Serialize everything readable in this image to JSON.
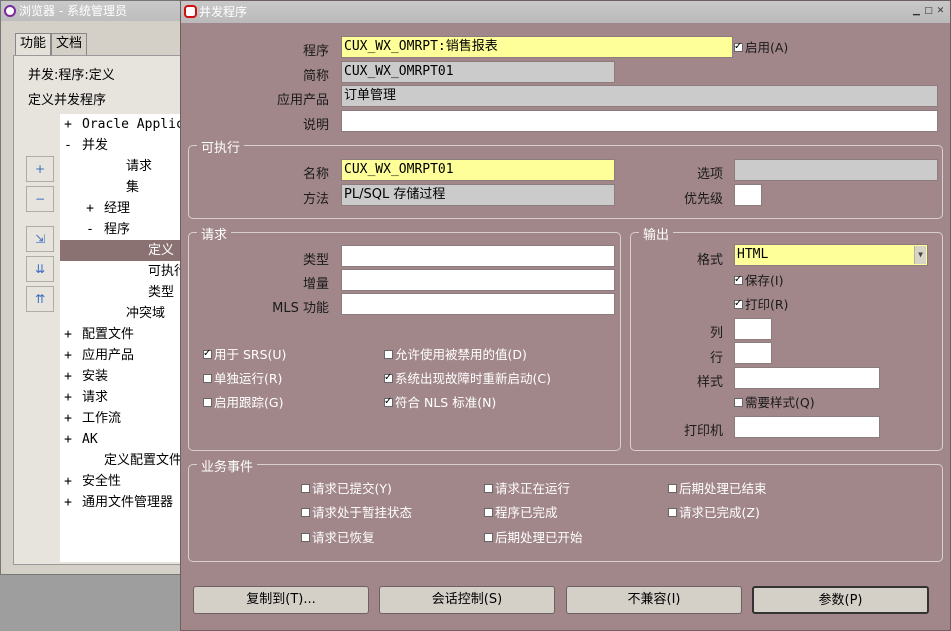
{
  "navigator": {
    "title": "浏览器 - 系统管理员",
    "tabs": [
      "功能",
      "文档"
    ],
    "function_path": "并发:程序:定义",
    "subtitle": "定义并发程序",
    "tree": [
      {
        "toggle": "+",
        "label": "Oracle Applic",
        "indent": 0
      },
      {
        "toggle": "-",
        "label": "并发",
        "indent": 0
      },
      {
        "toggle": "",
        "label": "请求",
        "indent": 2
      },
      {
        "toggle": "",
        "label": "集",
        "indent": 2
      },
      {
        "toggle": "+",
        "label": "经理",
        "indent": 1
      },
      {
        "toggle": "-",
        "label": "程序",
        "indent": 1
      },
      {
        "toggle": "",
        "label": "定义",
        "indent": 3,
        "selected": true
      },
      {
        "toggle": "",
        "label": "可执行",
        "indent": 3
      },
      {
        "toggle": "",
        "label": "类型",
        "indent": 3
      },
      {
        "toggle": "",
        "label": "冲突域",
        "indent": 2
      },
      {
        "toggle": "+",
        "label": "配置文件",
        "indent": 0
      },
      {
        "toggle": "+",
        "label": "应用产品",
        "indent": 0
      },
      {
        "toggle": "+",
        "label": "安装",
        "indent": 0
      },
      {
        "toggle": "+",
        "label": "请求",
        "indent": 0
      },
      {
        "toggle": "+",
        "label": "工作流",
        "indent": 0
      },
      {
        "toggle": "+",
        "label": "AK",
        "indent": 0
      },
      {
        "toggle": "",
        "label": "定义配置文件选",
        "indent": 1
      },
      {
        "toggle": "+",
        "label": "安全性",
        "indent": 0
      },
      {
        "toggle": "+",
        "label": "通用文件管理器",
        "indent": 0
      }
    ]
  },
  "form": {
    "title": "并发程序",
    "program_label": "程序",
    "program_value": "CUX_WX_OMRPT:销售报表",
    "enabled_label": "启用(A)",
    "short_name_label": "简称",
    "short_name_value": "CUX_WX_OMRPT01",
    "application_label": "应用产品",
    "application_value": "订单管理",
    "description_label": "说明",
    "description_value": "",
    "executable": {
      "title": "可执行",
      "name_label": "名称",
      "name_value": "CUX_WX_OMRPT01",
      "method_label": "方法",
      "method_value": "PL/SQL 存储过程",
      "options_label": "选项",
      "options_value": "",
      "priority_label": "优先级",
      "priority_value": ""
    },
    "request": {
      "title": "请求",
      "type_label": "类型",
      "increment_label": "增量",
      "mls_label": "MLS 功能",
      "use_in_srs": "用于 SRS(U)",
      "allow_disabled": "允许使用被禁用的值(D)",
      "run_alone": "单独运行(R)",
      "restart": "系统出现故障时重新启动(C)",
      "enable_trace": "启用跟踪(G)",
      "nls_compliant": "符合 NLS 标准(N)"
    },
    "output": {
      "title": "输出",
      "format_label": "格式",
      "format_value": "HTML",
      "save_label": "保存(I)",
      "print_label": "打印(R)",
      "columns_label": "列",
      "rows_label": "行",
      "style_label": "样式",
      "style_required_label": "需要样式(Q)",
      "printer_label": "打印机"
    },
    "business_events": {
      "title": "业务事件",
      "items": [
        "请求已提交(Y)",
        "请求正在运行",
        "后期处理已结束",
        "请求处于暂挂状态",
        "程序已完成",
        "请求已完成(Z)",
        "请求已恢复",
        "后期处理已开始"
      ]
    },
    "buttons": {
      "copy": "复制到(T)...",
      "session": "会话控制(S)",
      "incompatible": "不兼容(I)",
      "parameters": "参数(P)"
    }
  }
}
